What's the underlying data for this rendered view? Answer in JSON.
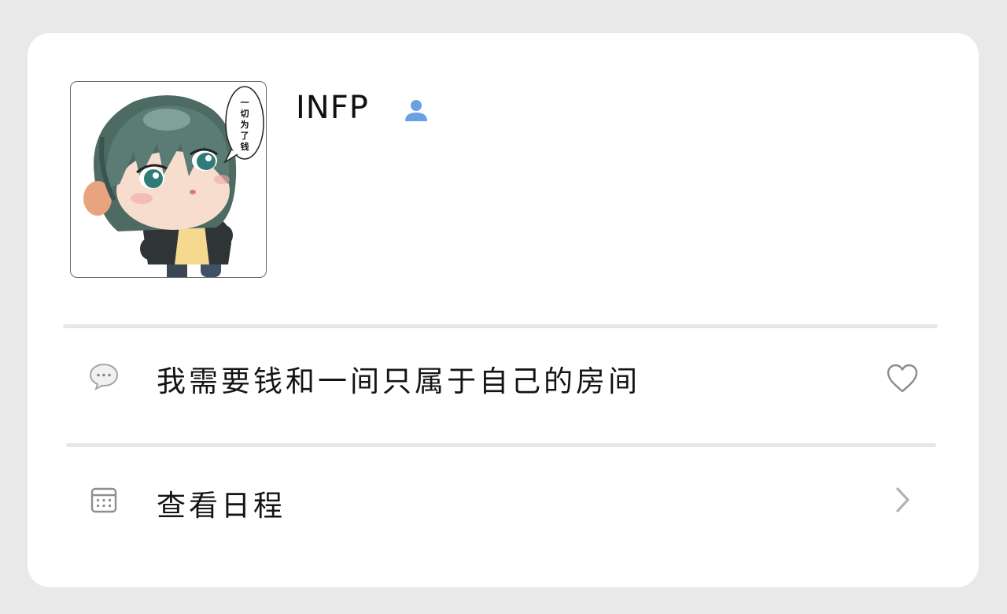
{
  "profile": {
    "username": "INFP",
    "avatar_caption": "一切为了钱",
    "person_icon": "person-icon",
    "person_icon_color": "#6aa0e3"
  },
  "rows": [
    {
      "icon": "chat-bubble-icon",
      "label": "我需要钱和一间只属于自己的房间",
      "action_icon": "heart-outline-icon"
    },
    {
      "icon": "calendar-icon",
      "label": "查看日程",
      "action_icon": "chevron-right-icon"
    }
  ],
  "colors": {
    "background": "#e9e9e9",
    "card": "#ffffff",
    "divider": "#e7e7e7",
    "icon_gray": "#9a9a9a"
  }
}
